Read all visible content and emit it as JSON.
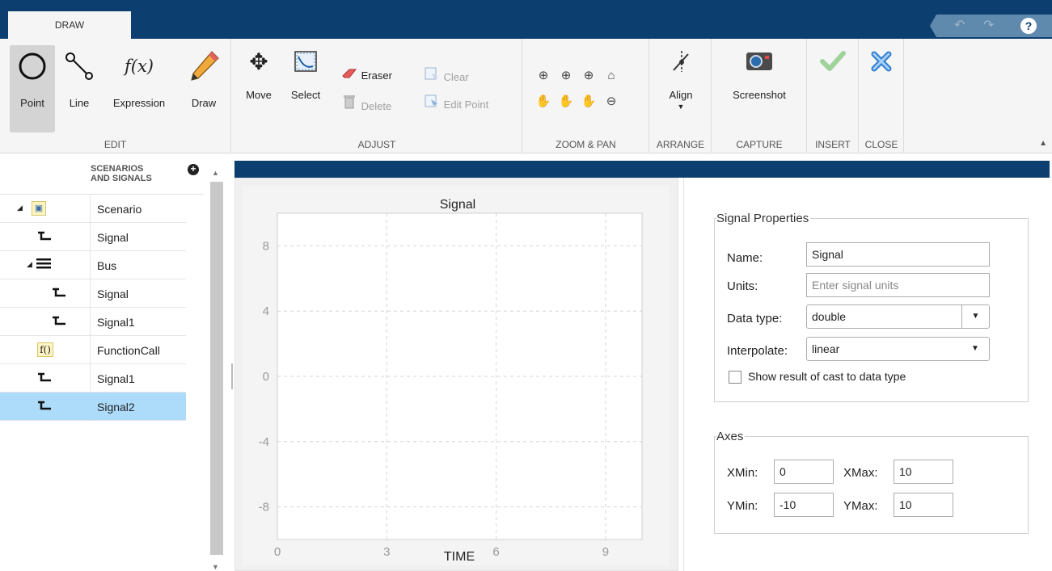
{
  "tabs": {
    "draw": "DRAW"
  },
  "quick_access": {
    "undo_icon": "undo-icon",
    "redo_icon": "redo-icon",
    "help": "?"
  },
  "toolstrip": {
    "edit": {
      "label": "EDIT",
      "point": "Point",
      "line": "Line",
      "expression": "Expression",
      "expression_icon_text": "f(x)",
      "draw": "Draw"
    },
    "adjust": {
      "label": "ADJUST",
      "move": "Move",
      "select": "Select",
      "eraser": "Eraser",
      "clear": "Clear",
      "delete": "Delete",
      "edit_point": "Edit Point"
    },
    "zoom_pan": {
      "label": "ZOOM & PAN"
    },
    "arrange": {
      "label": "ARRANGE",
      "align": "Align"
    },
    "capture": {
      "label": "CAPTURE",
      "screenshot": "Screenshot"
    },
    "insert": {
      "label": "INSERT"
    },
    "close": {
      "label": "CLOSE"
    }
  },
  "tree": {
    "header": "SCENARIOS AND SIGNALS",
    "header_line1": "SCENARIOS",
    "header_line2": "AND SIGNALS",
    "rows": [
      {
        "label": "Scenario",
        "icon": "scenario-icon"
      },
      {
        "label": "Signal",
        "icon": "signal-icon"
      },
      {
        "label": "Bus",
        "icon": "bus-icon"
      },
      {
        "label": "Signal",
        "icon": "signal-icon"
      },
      {
        "label": "Signal1",
        "icon": "signal-icon"
      },
      {
        "label": "FunctionCall",
        "icon": "function-call-icon"
      },
      {
        "label": "Signal1",
        "icon": "signal-icon"
      },
      {
        "label": "Signal2",
        "icon": "signal-icon",
        "selected": true
      }
    ]
  },
  "chart_data": {
    "type": "line",
    "title": "Signal",
    "xlabel": "TIME",
    "ylabel": "",
    "xlim": [
      0,
      10
    ],
    "ylim": [
      -10,
      10
    ],
    "x_ticks": [
      0,
      3,
      6,
      9
    ],
    "y_ticks": [
      8,
      4,
      0,
      -4,
      -8
    ],
    "grid": true,
    "series": []
  },
  "properties": {
    "legend": "Signal Properties",
    "name_label": "Name:",
    "name_value": "Signal",
    "units_label": "Units:",
    "units_placeholder": "Enter signal units",
    "datatype_label": "Data type:",
    "datatype_value": "double",
    "interpolate_label": "Interpolate:",
    "interpolate_value": "linear",
    "cast_label": "Show result of cast to data type"
  },
  "axes": {
    "legend": "Axes",
    "xmin_label": "XMin:",
    "xmin_value": "0",
    "xmax_label": "XMax:",
    "xmax_value": "10",
    "ymin_label": "YMin:",
    "ymin_value": "-10",
    "ymax_label": "YMax:",
    "ymax_value": "10"
  }
}
